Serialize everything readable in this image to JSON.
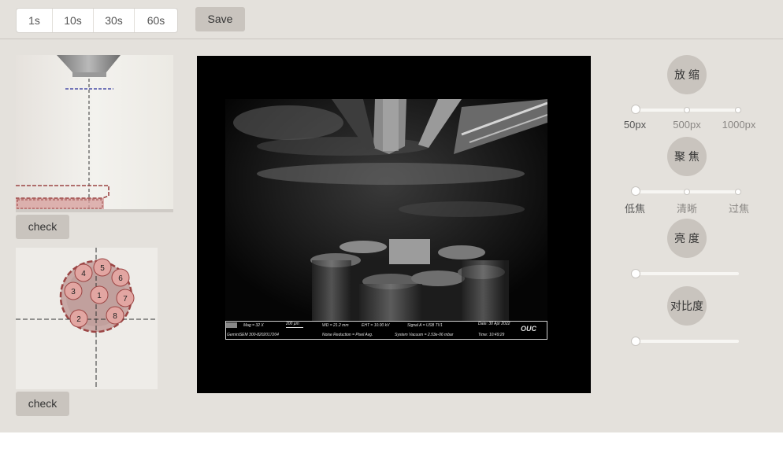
{
  "toolbar": {
    "intervals": [
      "1s",
      "10s",
      "30s",
      "60s"
    ],
    "save_label": "Save"
  },
  "left_panel": {
    "check_top": "check",
    "check_bottom": "check",
    "holder_numbers": [
      "1",
      "2",
      "3",
      "4",
      "5",
      "6",
      "7",
      "8"
    ]
  },
  "sem_info": {
    "mag": "Mag =    32 X",
    "scale": "200 µm",
    "wd": "WD = 21.2 mm",
    "eht": "EHT = 10.00 kV",
    "signal": "Signal A = USB TV1",
    "date": "Date: 30 Apr 2022",
    "instrument": "GeminiSEM 300-8202017204",
    "noise": "Noise Reduction = Pixel Avg.",
    "vacuum": "System Vacuum = 2.53e-06 mbar",
    "time": "Time: 10:49:29",
    "brand": "OUC"
  },
  "controls": {
    "zoom": {
      "label": "放 缩",
      "marks": [
        "50px",
        "500px",
        "1000px"
      ],
      "value_index": 0
    },
    "focus": {
      "label": "聚 焦",
      "marks": [
        "低焦",
        "清晰",
        "过焦"
      ],
      "value_index": 0
    },
    "brightness": {
      "label": "亮 度",
      "value": 0
    },
    "contrast": {
      "label": "对比度",
      "value": 0
    }
  }
}
